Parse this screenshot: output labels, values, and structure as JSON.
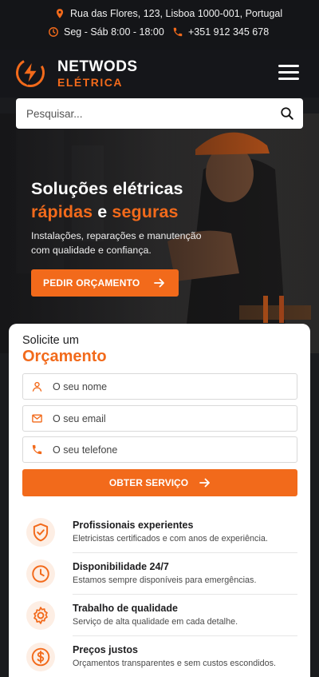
{
  "topbar": {
    "address": "Rua das Flores, 123, Lisboa 1000-001, Portugal",
    "hours": "Seg - Sáb 8:00 - 18:00",
    "phone": "+351 912 345 678",
    "icons": [
      "map-pin-icon",
      "clock-icon",
      "phone-icon"
    ]
  },
  "brand": {
    "name": "NETWODS",
    "sub": "ELÉTRICA"
  },
  "search": {
    "placeholder": "Pesquisar..."
  },
  "hero": {
    "title_line1": "Soluções elétricas",
    "title_word1": "rápidas",
    "title_and": "e",
    "title_word2": "seguras",
    "description": "Instalações, reparações e manutenção com qualidade e confiança.",
    "cta_label": "PEDIR ORÇAMENTO"
  },
  "quote_form": {
    "kicker": "Solicite um",
    "title": "Orçamento",
    "name_placeholder": "O seu nome",
    "email_placeholder": "O seu email",
    "phone_placeholder": "O seu telefone",
    "submit_label": "OBTER SERVIÇO"
  },
  "features": [
    {
      "icon": "shield-check-icon",
      "title": "Profissionais experientes",
      "desc": "Eletricistas certificados e com anos de experiência."
    },
    {
      "icon": "clock-icon",
      "title": "Disponibilidade 24/7",
      "desc": "Estamos sempre disponíveis para emergências."
    },
    {
      "icon": "gear-icon",
      "title": "Trabalho de qualidade",
      "desc": "Serviço de alta qualidade em cada detalhe."
    },
    {
      "icon": "dollar-coin-icon",
      "title": "Preços justos",
      "desc": "Orçamentos transparentes e sem custos escondidos."
    }
  ],
  "colors": {
    "accent": "#f26a1b",
    "dark": "#141518",
    "white": "#ffffff"
  }
}
